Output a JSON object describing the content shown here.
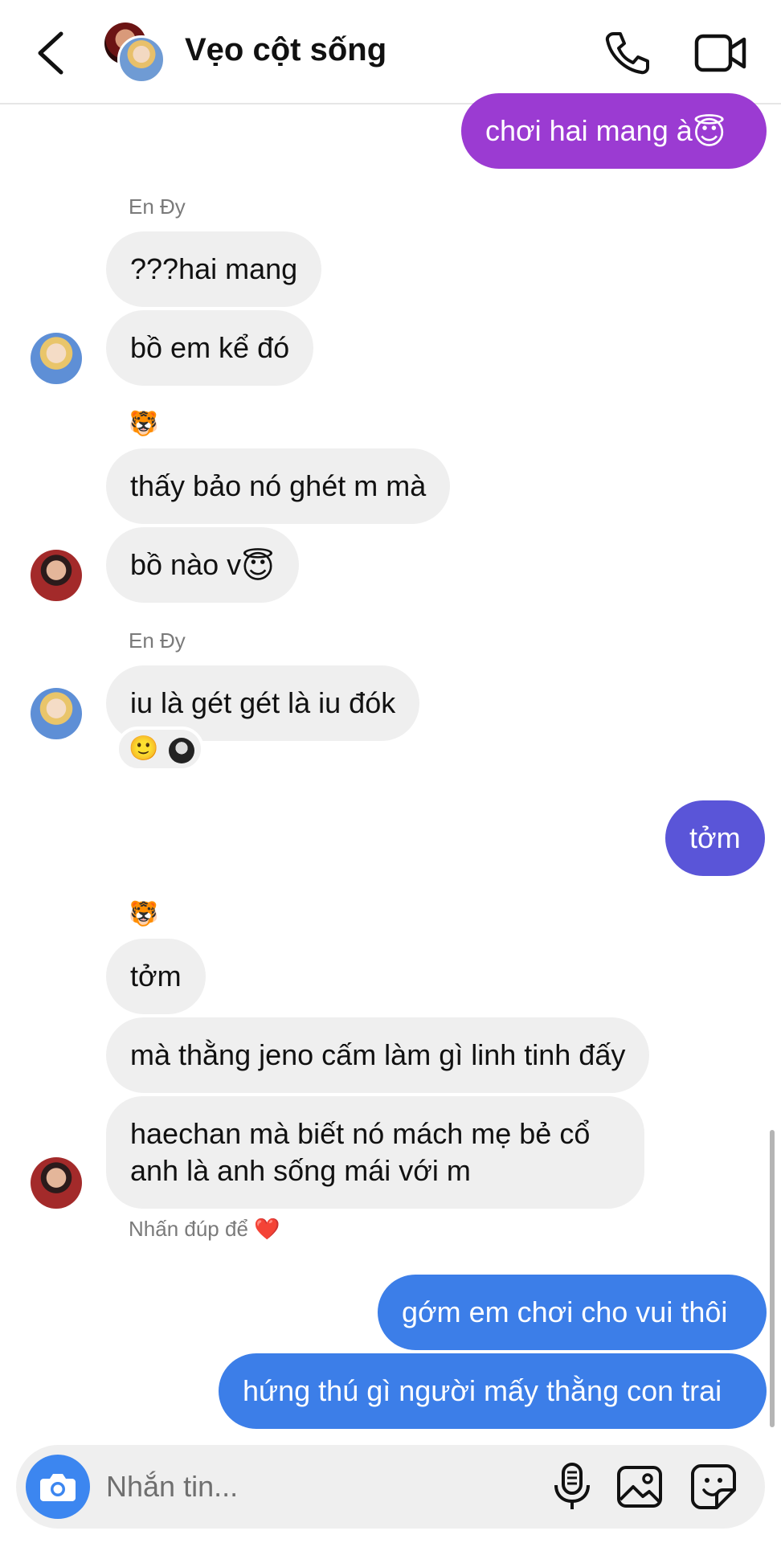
{
  "header": {
    "title": "Vẹo cột sống",
    "icons": [
      "back-arrow-icon",
      "phone-icon",
      "video-camera-icon"
    ]
  },
  "messages": [
    {
      "id": "m1",
      "side": "out",
      "text": "chơi hai mang à",
      "emoji": "😇",
      "color": "#9b3bd2"
    },
    {
      "id": "m2",
      "side": "in",
      "sender_label": "En Đy",
      "text": "???hai mang"
    },
    {
      "id": "m3",
      "side": "in",
      "text": "bồ em kể đó"
    },
    {
      "id": "m4",
      "side": "in",
      "sender_label": "🐯",
      "text": "thấy bảo nó ghét m mà"
    },
    {
      "id": "m5",
      "side": "in",
      "text": "bồ nào v",
      "emoji": "😇"
    },
    {
      "id": "m6",
      "side": "in",
      "sender_label": "En Đy",
      "text": "iu là gét gét là iu đók",
      "reaction": "🙂"
    },
    {
      "id": "m7",
      "side": "out",
      "text": "tởm",
      "color": "#5a55d8"
    },
    {
      "id": "m8",
      "side": "in",
      "sender_label": "🐯",
      "text": "tởm"
    },
    {
      "id": "m9",
      "side": "in",
      "text": "mà thằng jeno cấm làm gì linh tinh đấy"
    },
    {
      "id": "m10",
      "side": "in",
      "text": "haechan mà biết nó mách mẹ bẻ cổ anh là anh sống mái với m"
    },
    {
      "id": "m11",
      "side": "out",
      "text": "gớm em chơi cho vui thôi",
      "color": "#3c7ee8"
    },
    {
      "id": "m12",
      "side": "out",
      "text": "hứng thú gì người mấy thằng con trai",
      "color": "#3c7ee8"
    }
  ],
  "hint": {
    "text": "Nhấn đúp để",
    "heart": "❤️"
  },
  "composer": {
    "placeholder": "Nhắn tin...",
    "icons": [
      "camera-icon",
      "microphone-icon",
      "gallery-icon",
      "sticker-icon"
    ]
  },
  "colors": {
    "incoming_bubble": "#efefef",
    "camera_button": "#3c86f0"
  }
}
